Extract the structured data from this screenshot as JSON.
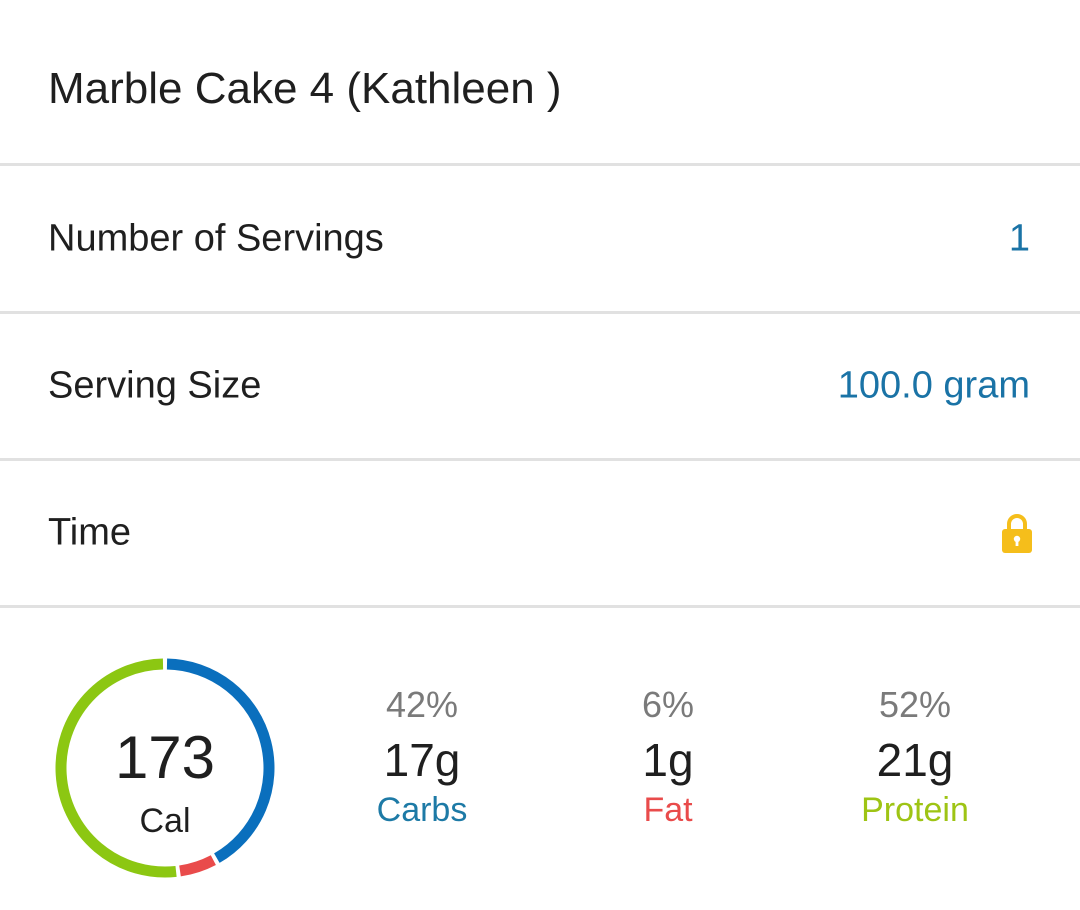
{
  "entry": {
    "title": "Marble Cake 4 (Kathleen )"
  },
  "rows": {
    "servings": {
      "label": "Number of Servings",
      "value": "1"
    },
    "size": {
      "label": "Serving Size",
      "value": "100.0 gram"
    },
    "time": {
      "label": "Time",
      "icon": "lock-icon"
    }
  },
  "summary": {
    "calories": "173",
    "calories_label": "Cal",
    "macros": {
      "carbs": {
        "percent": "42%",
        "grams": "17g",
        "name": "Carbs"
      },
      "fat": {
        "percent": "6%",
        "grams": "1g",
        "name": "Fat"
      },
      "protein": {
        "percent": "52%",
        "grams": "21g",
        "name": "Protein"
      }
    },
    "ring_shares": {
      "carbs": 0.42,
      "fat": 0.06,
      "protein": 0.52
    }
  },
  "colors": {
    "accent_blue": "#1a73a6",
    "carbs": "#1d7aa6",
    "carbs_ring": "#0a6fbd",
    "fat": "#e94b4b",
    "protein": "#9ec414",
    "protein_ring": "#8cc712",
    "lock": "#f5be1b",
    "divider": "#e1e1e1"
  }
}
